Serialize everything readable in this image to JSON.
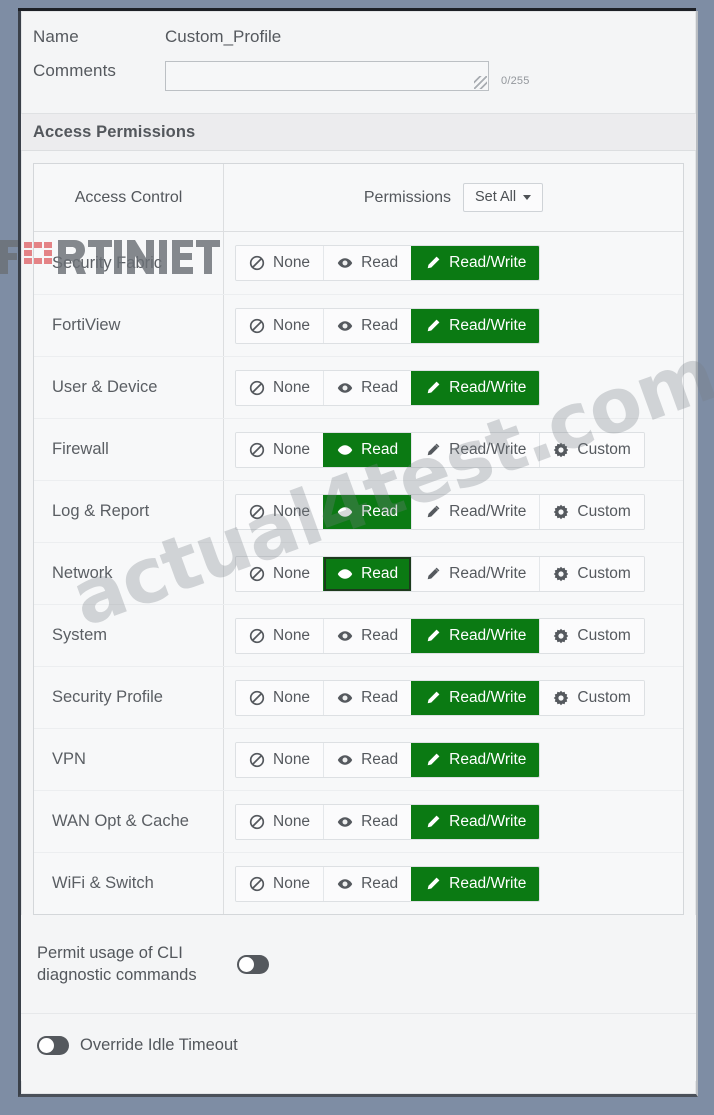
{
  "form": {
    "name_label": "Name",
    "name_value": "Custom_Profile",
    "comments_label": "Comments",
    "comments_value": "",
    "comments_placeholder": "",
    "comments_counter": "0/255"
  },
  "section": {
    "title": "Access Permissions"
  },
  "table": {
    "col_access_control": "Access Control",
    "col_permissions": "Permissions",
    "set_all_label": "Set All",
    "options": {
      "none": "None",
      "read": "Read",
      "read_write": "Read/Write",
      "custom": "Custom"
    },
    "rows": [
      {
        "name": "Security Fabric",
        "selected": "read_write",
        "has_custom": false,
        "focused": false
      },
      {
        "name": "FortiView",
        "selected": "read_write",
        "has_custom": false,
        "focused": false
      },
      {
        "name": "User & Device",
        "selected": "read_write",
        "has_custom": false,
        "focused": false
      },
      {
        "name": "Firewall",
        "selected": "read",
        "has_custom": true,
        "focused": false
      },
      {
        "name": "Log & Report",
        "selected": "read",
        "has_custom": true,
        "focused": false
      },
      {
        "name": "Network",
        "selected": "read",
        "has_custom": true,
        "focused": true
      },
      {
        "name": "System",
        "selected": "read_write",
        "has_custom": true,
        "focused": false
      },
      {
        "name": "Security Profile",
        "selected": "read_write",
        "has_custom": true,
        "focused": false
      },
      {
        "name": "VPN",
        "selected": "read_write",
        "has_custom": false,
        "focused": false
      },
      {
        "name": "WAN Opt & Cache",
        "selected": "read_write",
        "has_custom": false,
        "focused": false
      },
      {
        "name": "WiFi & Switch",
        "selected": "read_write",
        "has_custom": false,
        "focused": false
      }
    ]
  },
  "footer": {
    "cli_label": "Permit usage of CLI diagnostic commands",
    "cli_enabled": false,
    "idle_label": "Override Idle Timeout",
    "idle_enabled": false
  },
  "watermarks": {
    "brand": "FORTINET",
    "site": "actual4test.com"
  },
  "colors": {
    "selected_green": "#0b7a13",
    "page_background": "#7e8da4",
    "panel_background": "#f4f5f6"
  }
}
